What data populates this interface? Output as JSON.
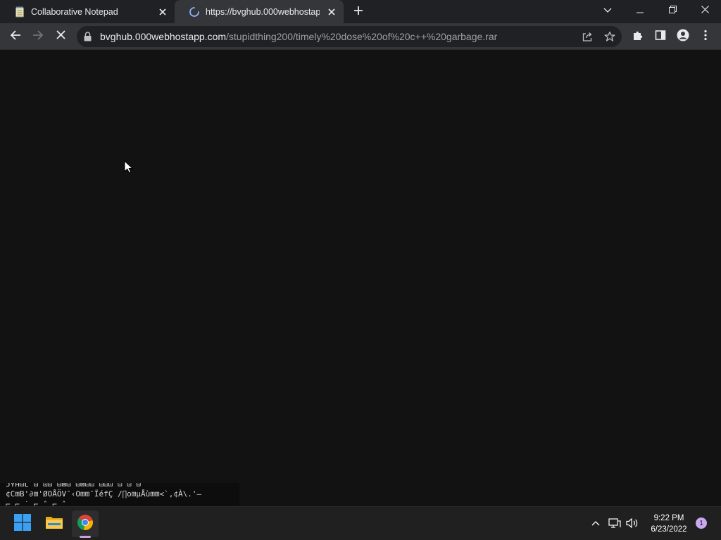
{
  "tabs": [
    {
      "title": "Collaborative Notepad",
      "icon": "notepad-icon",
      "active": false
    },
    {
      "title": "https://bvghub.000webhostapp.c",
      "icon": "loading-spinner-icon",
      "active": true
    }
  ],
  "window_controls": [
    "tab-search-icon",
    "minimize-icon",
    "restore-icon",
    "close-icon"
  ],
  "address_bar": {
    "host": "bvghub.000webhostapp.com",
    "path": "/stupidthing200/timely%20dose%20of%20c++%20garbage.rar"
  },
  "page": {
    "garbage_lines": [
      "ɔʏʜ⊟ʟ   ⊟ ⊡⊡  ⊟⊠⊟  ⊟⊠⊟⊡ ⊟⊡⊡       ⊡ ⊡     ⊟",
      "¢C⊞B'∂⊞'ØOÅÖV¯‹O⊞⊞¯ÏéfÇ /∏o⊞µÅù⊞⊞<`,¢À\\.'—",
      "  ⌐ ⌐  ˙  ⌐ ˆ       ⌐  ˆ"
    ]
  },
  "taskbar": {
    "time": "9:22 PM",
    "date": "6/23/2022",
    "notification_count": "1"
  },
  "colors": {
    "tabstrip": "#202124",
    "toolbar": "#35363a",
    "omnibox": "#202124",
    "page_background": "#121212",
    "taskbar": "#202020",
    "notification_badge": "#c9a9f0"
  }
}
